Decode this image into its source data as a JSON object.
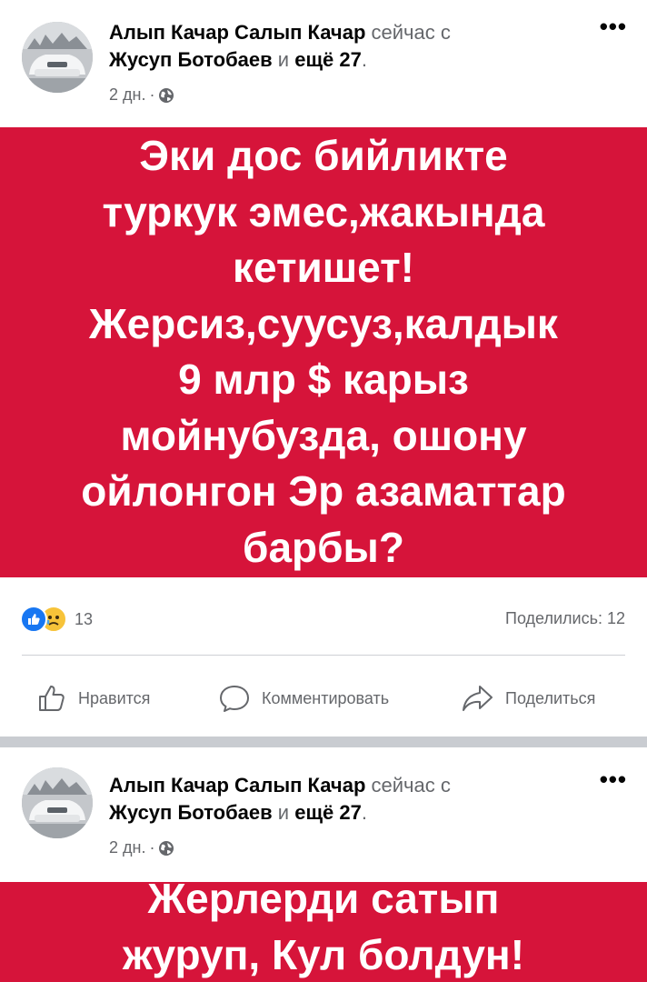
{
  "posts": [
    {
      "author": "Алып Качар Салып Качар",
      "status": "сейчас с",
      "tagged": "Жусуп Ботобаев",
      "and_more_connector": "и",
      "and_more": "ещё 27",
      "time": "2 дн.",
      "menu": "•••",
      "banner_text": "Эки дос бийликте\nтуркук эмес,жакында\nкетишет!\nЖерсиз,суусуз,калдык\n9 млр $ карыз\nмойнубузда, ошону\nойлонгон Эр азаматтар\nбарбы?",
      "reaction_count": "13",
      "shares": "Поделились: 12",
      "actions": {
        "like": "Нравится",
        "comment": "Комментировать",
        "share": "Поделиться"
      }
    },
    {
      "author": "Алып Качар Салып Качар",
      "status": "сейчас с",
      "tagged": "Жусуп Ботобаев",
      "and_more_connector": "и",
      "and_more": "ещё 27",
      "time": "2 дн.",
      "menu": "•••",
      "banner_text": "Жерлерди сатып\nжуруп, Кул болдун!"
    }
  ],
  "colors": {
    "banner_red": "#d6143a",
    "text_secondary": "#65676b",
    "like_blue": "#1877f2",
    "sad_yellow": "#f7c339"
  },
  "icons": [
    "avatar-car-photo",
    "globe-icon",
    "like-reaction-icon",
    "sad-reaction-icon",
    "thumbs-up-icon",
    "comment-bubble-icon",
    "share-arrow-icon",
    "more-options-icon"
  ]
}
